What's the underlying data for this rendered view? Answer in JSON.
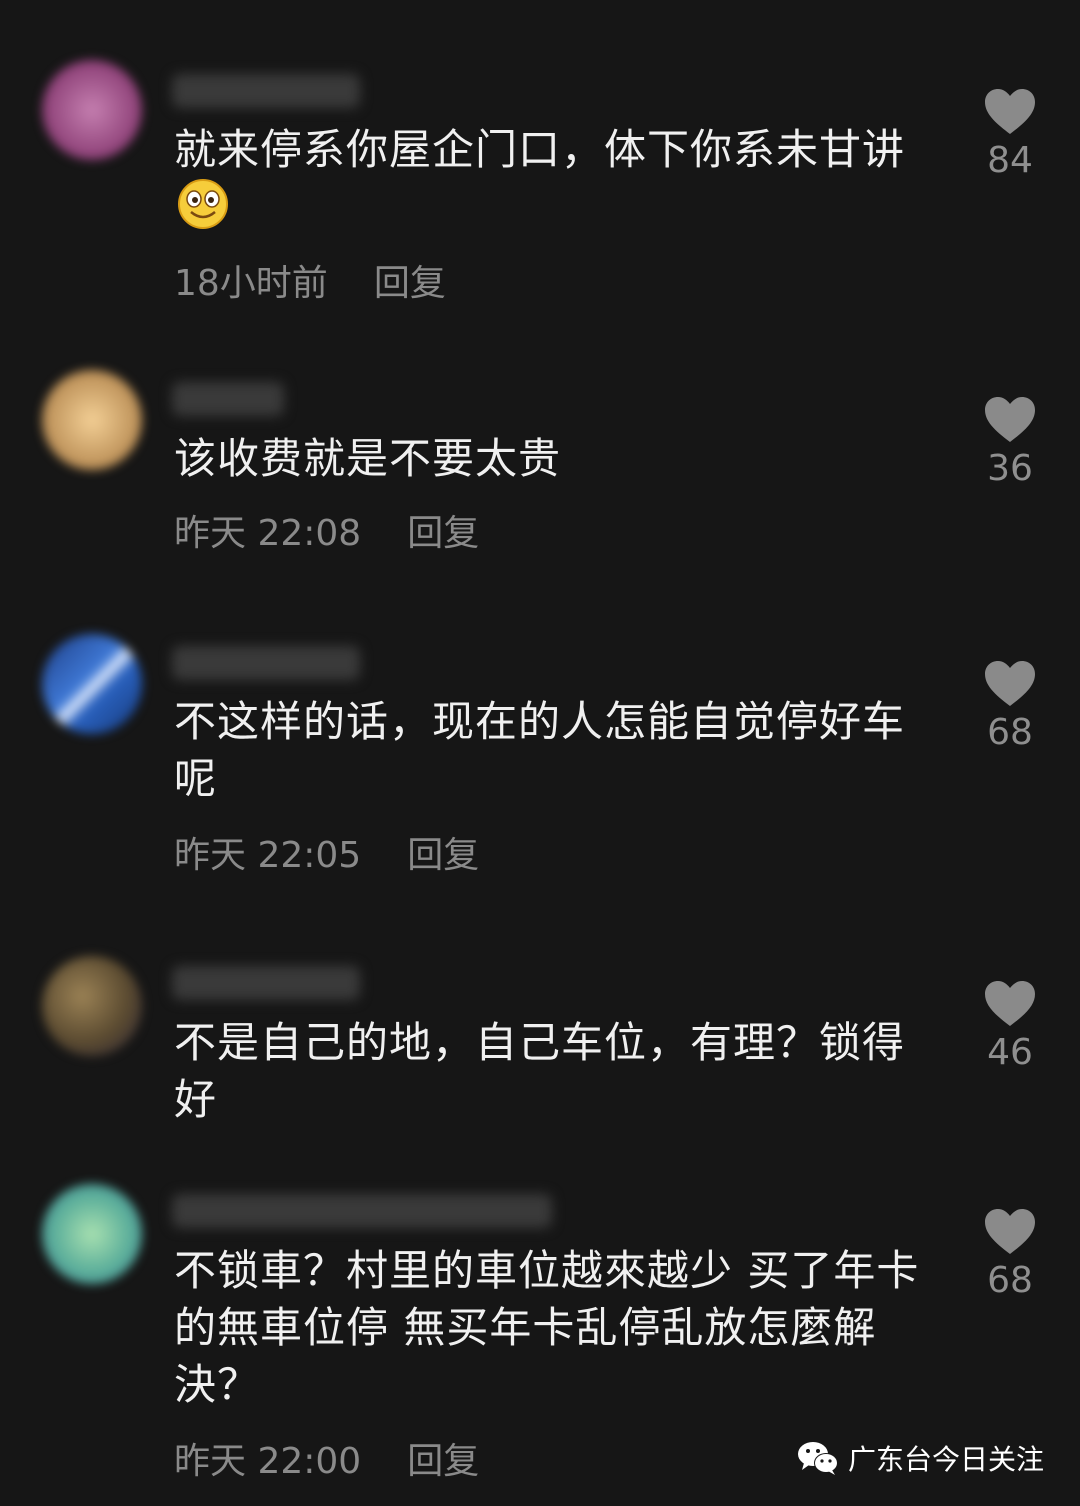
{
  "comments": [
    {
      "text": "就来停系你屋企门口，体下你系未甘讲",
      "emoji": "smiling-face-emoji",
      "time": "18小时前",
      "reply": "回复",
      "likes": "84",
      "avatar_color": "#a0538a"
    },
    {
      "text": "该收费就是不要太贵",
      "time": "昨天 22:08",
      "reply": "回复",
      "likes": "36",
      "avatar_color": "#d9b07a"
    },
    {
      "text": "不这样的话，现在的人怎能自觉停好车呢",
      "time": "昨天 22:05",
      "reply": "回复",
      "likes": "68",
      "avatar_color": "#2c5fa8"
    },
    {
      "text": "不是自己的地，自己车位，有理？锁得好",
      "time": "",
      "reply": "",
      "likes": "46",
      "avatar_color": "#6a5a3a"
    },
    {
      "text": "不锁車？村里的車位越來越少 买了年卡的無車位停 無买年卡乱停乱放怎麼解決？",
      "time": "昨天 22:00",
      "reply": "回复",
      "likes": "68",
      "avatar_color": "#6fb8a0"
    }
  ],
  "watermark": {
    "icon": "wechat-icon",
    "text": "广东台今日关注"
  }
}
